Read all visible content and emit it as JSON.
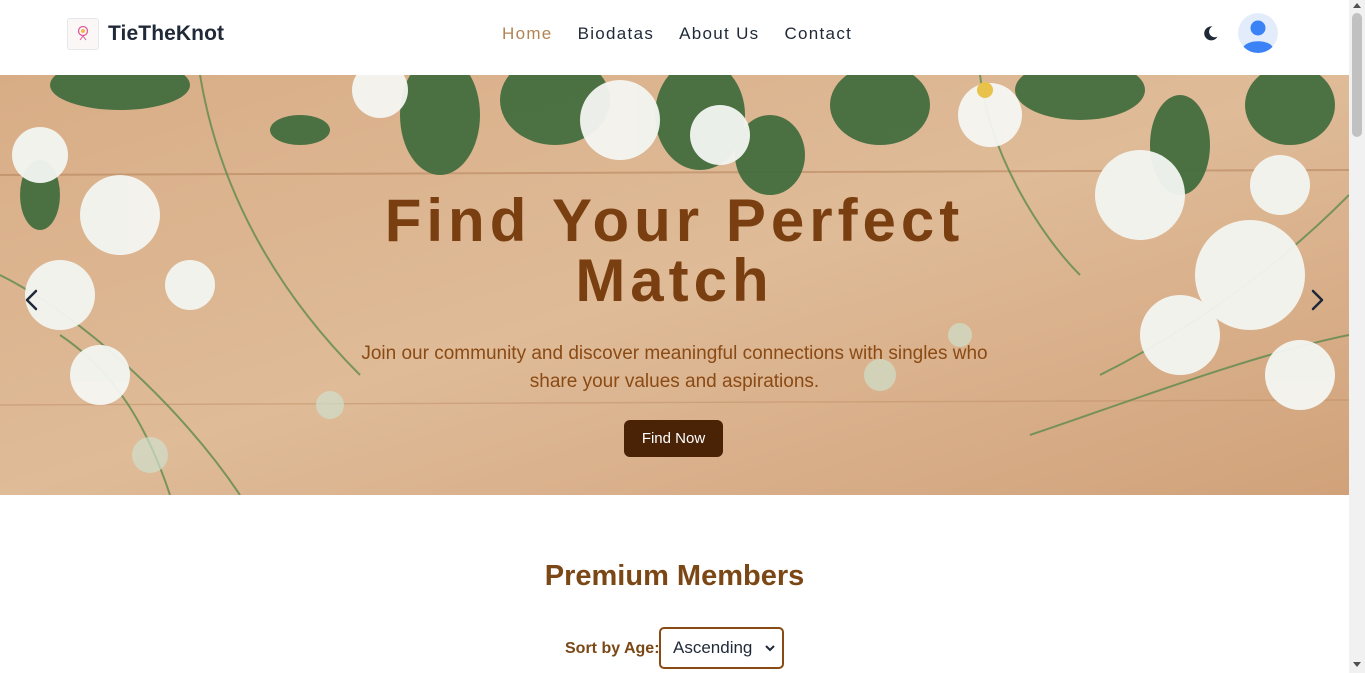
{
  "navbar": {
    "brand": "TieTheKnot",
    "links": [
      {
        "label": "Home",
        "active": true
      },
      {
        "label": "Biodatas",
        "active": false
      },
      {
        "label": "About Us",
        "active": false
      },
      {
        "label": "Contact",
        "active": false
      }
    ],
    "theme_toggle_icon": "moon-icon",
    "avatar_icon": "user-avatar-icon",
    "active_color": "#b08453"
  },
  "hero": {
    "title": "Find Your Perfect Match",
    "subtitle": "Join our community and discover meaningful connections with singles who share your values and aspirations.",
    "button_label": "Find Now",
    "prev_icon": "chevron-left-icon",
    "next_icon": "chevron-right-icon",
    "title_color": "#7a3f10",
    "button_color": "#4a2206"
  },
  "premium": {
    "title": "Premium Members",
    "sort_label": "Sort by Age:",
    "sort_value": "Ascending"
  }
}
